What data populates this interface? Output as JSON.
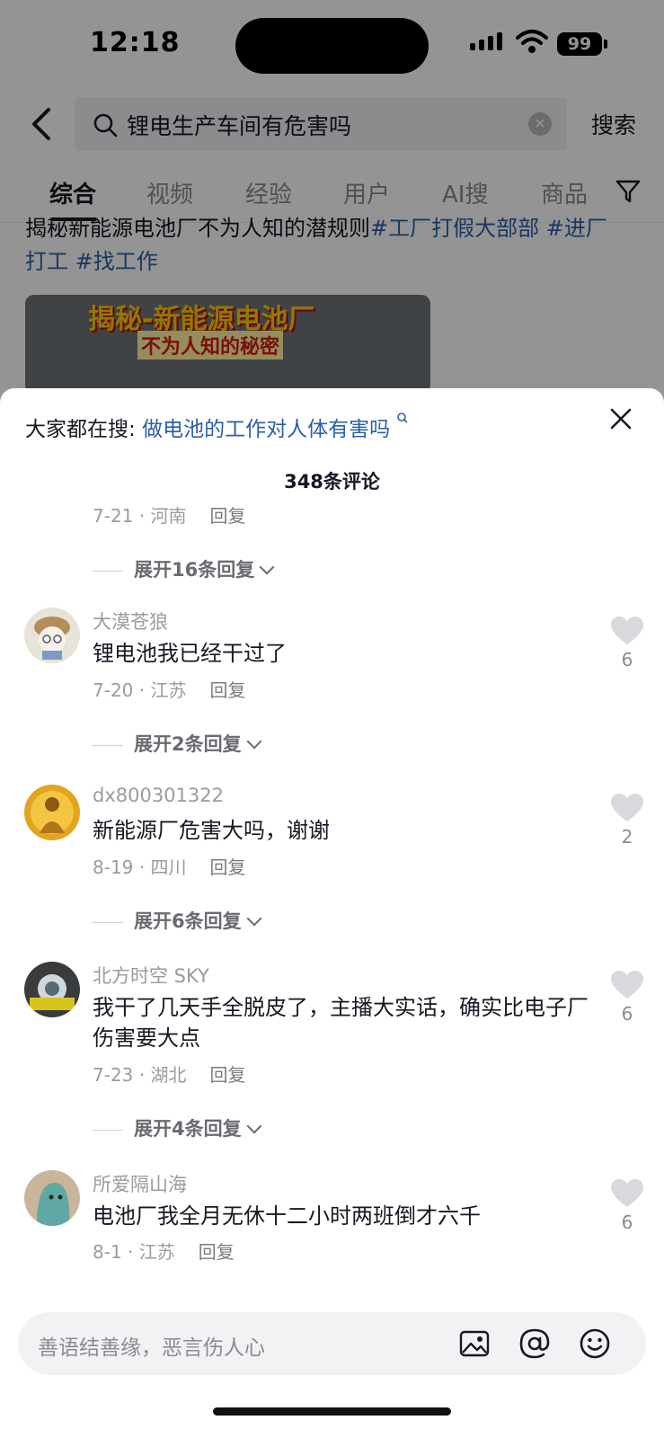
{
  "status_bar": {
    "time": "12:18",
    "battery": "99"
  },
  "search": {
    "query": "锂电生产车间有危害吗",
    "button_label": "搜索"
  },
  "tabs": [
    {
      "label": "综合",
      "active": true
    },
    {
      "label": "视频"
    },
    {
      "label": "经验"
    },
    {
      "label": "用户"
    },
    {
      "label": "AI搜"
    },
    {
      "label": "商品"
    }
  ],
  "background_post": {
    "text_line1": "揭秘新能源电池厂不为人知的潜规则",
    "tags_line1": "#工厂打假大部部 #进厂",
    "tags_line2": "打工 #找工作",
    "thumb_line1": "揭秘-新能源电池厂",
    "thumb_line2": "不为人知的秘密"
  },
  "comment_sheet": {
    "hot_search_prefix": "大家都在搜:",
    "hot_search_link": "做电池的工作对人体有害吗",
    "count_label": "348条评论",
    "top_meta": {
      "date_location": "7-21 · 河南",
      "reply": "回复"
    },
    "top_expand": "展开16条回复",
    "comments": [
      {
        "user": "大漠苍狼",
        "text": "锂电池我已经干过了",
        "date_location": "7-20 · 江苏",
        "reply": "回复",
        "likes": "6",
        "expand": "展开2条回复"
      },
      {
        "user": "dx800301322",
        "text": "新能源厂危害大吗，谢谢",
        "date_location": "8-19 · 四川",
        "reply": "回复",
        "likes": "2",
        "expand": "展开6条回复"
      },
      {
        "user": "北方时空 SKY",
        "text": "我干了几天手全脱皮了，主播大实话，确实比电子厂伤害要大点",
        "date_location": "7-23 · 湖北",
        "reply": "回复",
        "likes": "6",
        "expand": "展开4条回复"
      },
      {
        "user": "所爱隔山海",
        "text": "电池厂我全月无休十二小时两班倒才六千",
        "date_location": "8-1 · 江苏",
        "reply": "回复",
        "likes": "6"
      }
    ],
    "input_placeholder": "善语结善缘，恶言伤人心"
  },
  "colors": {
    "link": "#2a5faa",
    "text": "#161823",
    "muted": "#9a9ba0"
  }
}
